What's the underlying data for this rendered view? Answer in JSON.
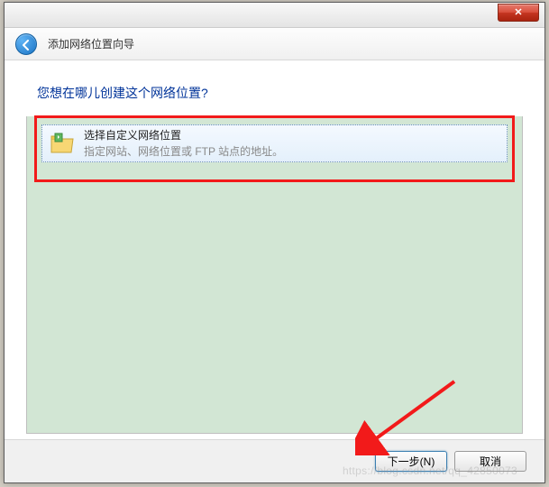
{
  "titlebar": {
    "close_glyph": "✕"
  },
  "header": {
    "title": "添加网络位置向导"
  },
  "content": {
    "prompt": "您想在哪儿创建这个网络位置?",
    "option": {
      "title": "选择自定义网络位置",
      "desc": "指定网站、网络位置或 FTP 站点的地址。"
    }
  },
  "footer": {
    "next_label": "下一步(N)",
    "cancel_label": "取消"
  },
  "watermark": "https://blog.csdn.net/qq_42850073"
}
